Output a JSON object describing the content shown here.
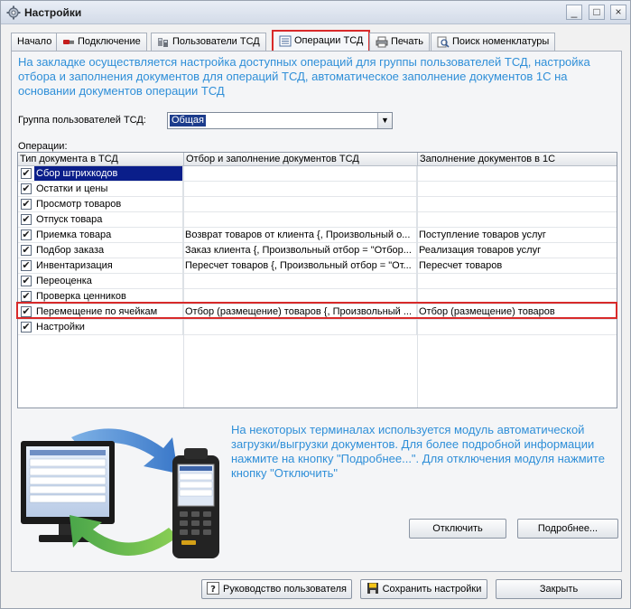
{
  "window": {
    "title": "Настройки",
    "controls": [
      "_",
      "□",
      "×"
    ]
  },
  "tabs": [
    {
      "label": "Начало",
      "icon": ""
    },
    {
      "label": "Подключение",
      "icon": "plug-icon"
    },
    {
      "label": "Пользователи ТСД",
      "icon": "users-icon"
    },
    {
      "label": "Операции ТСД",
      "icon": "list-icon",
      "active": true
    },
    {
      "label": "Печать",
      "icon": "printer-icon"
    },
    {
      "label": "Поиск номенклатуры",
      "icon": "search-icon"
    }
  ],
  "info_top": "На закладке осуществляется настройка доступных операций для группы пользователей ТСД, настройка отбора  и  заполнения  документов  для операций ТСД, автоматическое заполнение документов  1С на основании документов  операции ТСД",
  "group": {
    "label": "Группа пользователей ТСД:",
    "value": "Общая"
  },
  "operations": {
    "label": "Операции:",
    "columns": [
      "Тип документа в ТСД",
      "Отбор  и заполнение документов ТСД",
      "Заполнение документов в 1С"
    ],
    "rows": [
      {
        "name": "Сбор штрихкодов",
        "filter": "",
        "fill": "",
        "checked": true,
        "selected": true
      },
      {
        "name": "Остатки и цены",
        "filter": "",
        "fill": "",
        "checked": true
      },
      {
        "name": "Просмотр товаров",
        "filter": "",
        "fill": "",
        "checked": true
      },
      {
        "name": "Отпуск товара",
        "filter": "",
        "fill": "",
        "checked": true
      },
      {
        "name": "Приемка товара",
        "filter": "Возврат товаров от клиента {, Произвольный о...",
        "fill": "Поступление товаров услуг",
        "checked": true
      },
      {
        "name": "Подбор заказа",
        "filter": "Заказ клиента {, Произвольный отбор = \"Отбор...",
        "fill": "Реализация товаров услуг",
        "checked": true
      },
      {
        "name": "Инвентаризация",
        "filter": "Пересчет товаров {, Произвольный отбор = \"От...",
        "fill": "Пересчет товаров",
        "checked": true
      },
      {
        "name": "Переоценка",
        "filter": "",
        "fill": "",
        "checked": true
      },
      {
        "name": "Проверка ценников",
        "filter": "",
        "fill": "",
        "checked": true
      },
      {
        "name": "Перемещение по ячейкам",
        "filter": "Отбор (размещение) товаров {, Произвольный ...",
        "fill": "Отбор (размещение) товаров",
        "checked": true
      },
      {
        "name": "Настройки",
        "filter": "",
        "fill": "",
        "checked": true
      }
    ]
  },
  "info_bottom": "На некоторых терминалах используется модуль автоматической загрузки/выгрузки документов. Для более подробной информации нажмите на кнопку \"Подробнее...\". Для отключения модуля нажмите кнопку \"Отключить\"",
  "buttons": {
    "disable": "Отключить",
    "details": "Подробнее...",
    "guide": "Руководство пользователя",
    "save": "Сохранить настройки",
    "close": "Закрыть"
  },
  "colors": {
    "info_text": "#2f8fd8",
    "highlight": "#d82a2a",
    "selection": "#0a1e8a"
  }
}
